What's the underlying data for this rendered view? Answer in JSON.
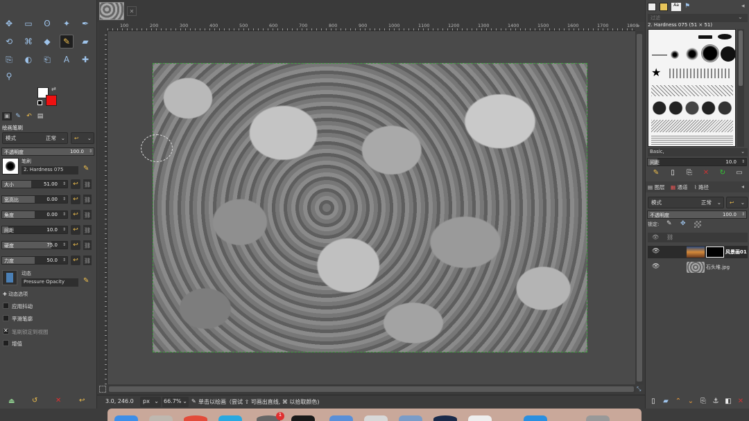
{
  "toolbox": {
    "tools": [
      {
        "icon": "move-icon",
        "glyph": "✥"
      },
      {
        "icon": "rect-select-icon",
        "glyph": "▭"
      },
      {
        "icon": "lasso-icon",
        "glyph": "ʘ"
      },
      {
        "icon": "fuzzy-select-icon",
        "glyph": "✦"
      },
      {
        "icon": "paths-icon",
        "glyph": "✒"
      },
      {
        "icon": "transform-icon",
        "glyph": "⟲"
      },
      {
        "icon": "warp-icon",
        "glyph": "⌘"
      },
      {
        "icon": "bucket-fill-icon",
        "glyph": "◆"
      },
      {
        "icon": "paintbrush-icon",
        "glyph": "✎"
      },
      {
        "icon": "eraser-icon",
        "glyph": "▰"
      },
      {
        "icon": "clone-icon",
        "glyph": "⎘"
      },
      {
        "icon": "smudge-icon",
        "glyph": "◐"
      },
      {
        "icon": "color-picker-icon",
        "glyph": "⎗"
      },
      {
        "icon": "text-icon",
        "glyph": "A"
      },
      {
        "icon": "align-icon",
        "glyph": "✚"
      },
      {
        "icon": "zoom-icon",
        "glyph": "⚲"
      }
    ],
    "fg_color": "#ffffff",
    "bg_color": "#ee1111"
  },
  "tool_options": {
    "title": "绘画笔刷",
    "mode_label": "模式",
    "mode_value": "正常",
    "opacity_label": "不透明度",
    "opacity_value": "100.0",
    "brush_label": "笔刷",
    "brush_name": "2. Hardness 075",
    "sliders": [
      {
        "label": "大小",
        "value": "51.00",
        "fill": 0.45
      },
      {
        "label": "宽高比",
        "value": "0.00",
        "fill": 0.5
      },
      {
        "label": "角度",
        "value": "0.00",
        "fill": 0.5
      },
      {
        "label": "间距",
        "value": "10.0",
        "fill": 0.1
      },
      {
        "label": "硬度",
        "value": "75.0",
        "fill": 0.75
      },
      {
        "label": "力度",
        "value": "50.0",
        "fill": 0.5
      }
    ],
    "dynamics_label": "动态",
    "dynamics_value": "Pressure Opacity",
    "dynamics_options": "动态选项",
    "checks": [
      {
        "label": "应用抖动",
        "checked": false
      },
      {
        "label": "平滑笔廓",
        "checked": false
      },
      {
        "label": "笔刷锁定到视图",
        "checked": true
      },
      {
        "label": "增值",
        "checked": false
      }
    ]
  },
  "ruler": {
    "labels": [
      "100",
      "200",
      "300",
      "400",
      "500",
      "600",
      "700",
      "800",
      "900",
      "1000",
      "1100",
      "1200",
      "1300",
      "1400",
      "1500",
      "1600",
      "1700",
      "1800"
    ]
  },
  "status": {
    "coords": "3.0, 246.0",
    "unit": "px",
    "zoom": "66.7%",
    "message": "单击以绘画（尝试 ⇧ 可画出直线, ⌘ 以拾取颜色)"
  },
  "brushes_panel": {
    "filter_placeholder": "过滤",
    "brush_title": "2. Hardness 075 (51 × 51)",
    "preset": "Basic,",
    "spacing_label": "间距",
    "spacing_value": "10.0"
  },
  "layers_panel": {
    "tabs": [
      "图层",
      "通道",
      "路径"
    ],
    "mode_label": "模式",
    "mode_value": "正常",
    "opacity_label": "不透明度",
    "opacity_value": "100.0",
    "lock_label": "锁定:",
    "layers": [
      {
        "name": "风景画01",
        "selected": true
      },
      {
        "name": "石头堆.jpg",
        "selected": false
      }
    ]
  }
}
